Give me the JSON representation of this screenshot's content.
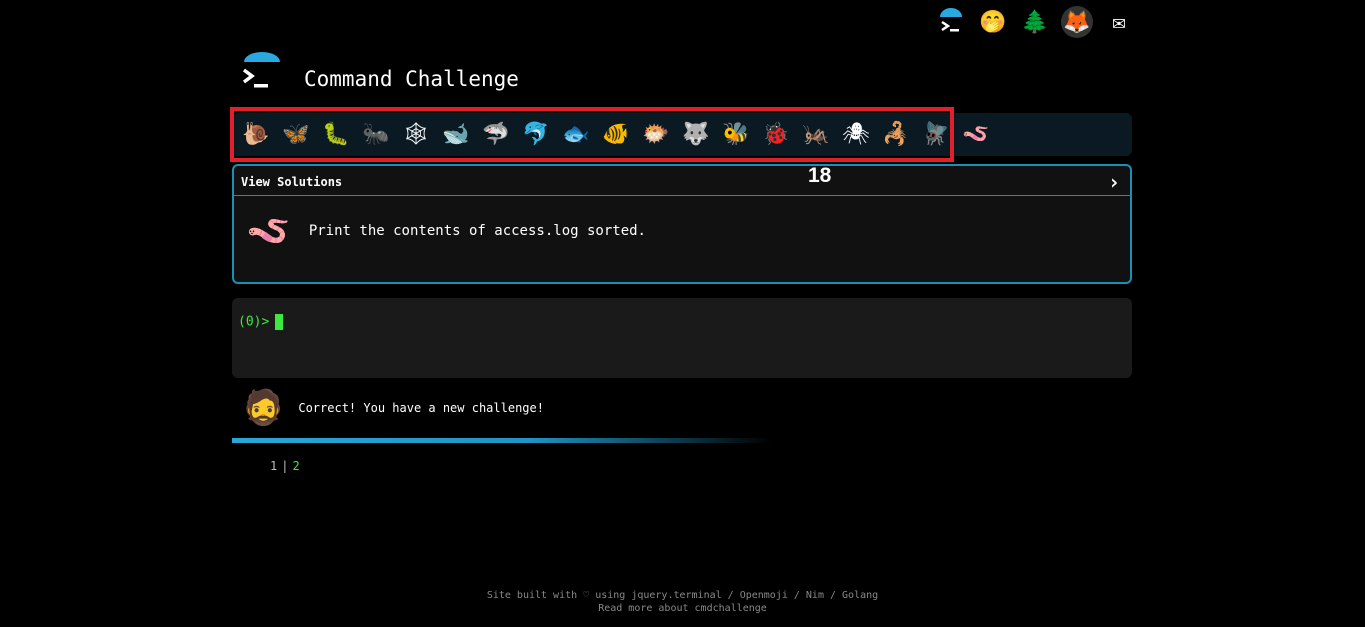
{
  "topbar": {
    "icons": [
      "terminal-icon",
      "hand-over-mouth-face-icon",
      "tree-icon",
      "gitlab-icon",
      "envelope-icon"
    ],
    "glyphs": [
      "▶",
      "🤭",
      "🌲",
      "🦊",
      "✉"
    ]
  },
  "header": {
    "title": "Command Challenge"
  },
  "emoji_bar": {
    "icons": [
      "snail",
      "butterfly",
      "caterpillar",
      "ant",
      "spider-web",
      "whale",
      "shark",
      "dolphin",
      "fish",
      "tropical-fish",
      "blowfish",
      "wolf",
      "bee",
      "ladybug",
      "cricket",
      "spider",
      "scorpion",
      "fly",
      "worm"
    ],
    "glyphs": [
      "🐌",
      "🦋",
      "🐛",
      "🐜",
      "🕸",
      "🐋",
      "🦈",
      "🐬",
      "🐟",
      "🐠",
      "🐡",
      "🐺",
      "🐝",
      "🐞",
      "🦗",
      "🕷",
      "🦂",
      "🪰",
      "🪱"
    ],
    "count": "18"
  },
  "challenge": {
    "header": "View Solutions",
    "chevron": "›",
    "text": "Print the contents of access.log sorted.",
    "worm_glyph": "🪱"
  },
  "terminal": {
    "prompt": "(0)>"
  },
  "feedback": {
    "text": "Correct! You have a new challenge!",
    "avatar": "🧔"
  },
  "pager": {
    "pages": [
      "1",
      "2"
    ],
    "current": "2"
  },
  "footer": {
    "line1": "Site built with ♡ using jquery.terminal / Openmoji / Nim / Golang",
    "line2": "Read more about cmdchallenge"
  },
  "colors": {
    "accent": "#1c8fb5",
    "prompt": "#3ee83e",
    "highlight": "#e0202a"
  }
}
